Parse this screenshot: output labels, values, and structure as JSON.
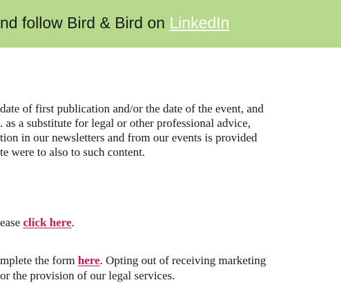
{
  "banner": {
    "prefix": "nd follow Bird & Bird on ",
    "link": "LinkedIn"
  },
  "disclaimer": {
    "lines": [
      "date of first publication and/or the date of the event, and",
      ". as a substitute for legal or other professional advice,",
      "tion in our newsletters and from our events is provided",
      "te were to also to such content."
    ]
  },
  "unsubscribe": {
    "prefix": "ease ",
    "link": "click here",
    "suffix": "."
  },
  "optout": {
    "prefix": "mplete the form ",
    "link": "here",
    "suffix": ". Opting out of receiving marketing",
    "line2": "or the provision of our legal services."
  },
  "colors": {
    "banner_bg": "#b6d98b",
    "link": "#c2185b",
    "banner_link": "#ffffff"
  }
}
